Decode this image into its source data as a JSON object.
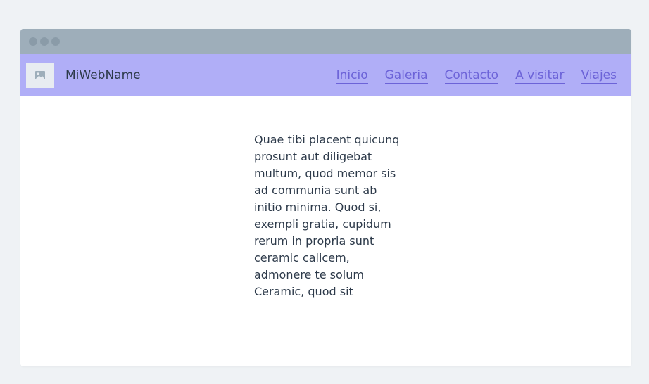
{
  "header": {
    "site_name": "MiWebName",
    "logo_icon": "image-icon"
  },
  "nav": {
    "items": [
      {
        "label": "Inicio"
      },
      {
        "label": "Galeria"
      },
      {
        "label": "Contacto"
      },
      {
        "label": "A visitar"
      },
      {
        "label": "Viajes"
      }
    ]
  },
  "main": {
    "paragraph": "Quae tibi placent quicunq prosunt aut diligebat multum, quod memor sis ad communia sunt ab initio minima. Quod si, exempli gratia, cupidum rerum in propria sunt ceramic calicem, admonere te solum Ceramic, quod sit"
  },
  "colors": {
    "page_bg": "#eff2f5",
    "titlebar": "#9eaeba",
    "navbar": "#b0aef7",
    "link": "#6c63d8",
    "text": "#2d3a4a"
  }
}
